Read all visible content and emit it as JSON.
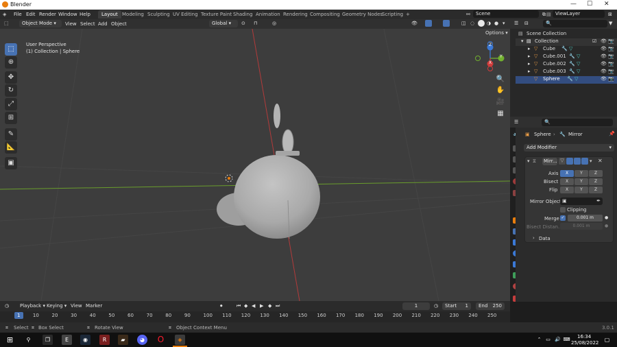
{
  "window": {
    "title": "Blender"
  },
  "menu": [
    "File",
    "Edit",
    "Render",
    "Window",
    "Help"
  ],
  "workspaces": [
    "Layout",
    "Modeling",
    "Sculpting",
    "UV Editing",
    "Texture Paint",
    "Shading",
    "Animation",
    "Rendering",
    "Compositing",
    "Geometry Nodes",
    "Scripting"
  ],
  "active_workspace": "Layout",
  "add_workspace": "+",
  "scene": {
    "name": "Scene",
    "view_layer": "ViewLayer"
  },
  "header3d": {
    "mode": "Object Mode",
    "view": "View",
    "select": "Select",
    "add": "Add",
    "object": "Object",
    "orientation": "Global",
    "options": "Options"
  },
  "viewport": {
    "perspective": "User Perspective",
    "collection_info": "(1) Collection | Sphere"
  },
  "gizmo": {
    "x": "X",
    "y": "Y",
    "z": "Z"
  },
  "outliner": {
    "root": "Scene Collection",
    "collection": "Collection",
    "items": [
      {
        "name": "Cube"
      },
      {
        "name": "Cube.001"
      },
      {
        "name": "Cube.002"
      },
      {
        "name": "Cube.003"
      },
      {
        "name": "Sphere"
      }
    ]
  },
  "properties": {
    "object": "Sphere",
    "modifier_context": "Mirror",
    "add_modifier": "Add Modifier",
    "modifier": {
      "name": "Mirr...",
      "axis_label": "Axis",
      "bisect_label": "Bisect",
      "flip_label": "Flip",
      "axes": [
        "X",
        "Y",
        "Z"
      ],
      "axis_enabled": [
        true,
        false,
        false
      ],
      "mirror_object_label": "Mirror Object",
      "clipping_label": "Clipping",
      "merge_label": "Merge",
      "merge_value": "0.001 m",
      "bisect_distance_label": "Bisect Distan...",
      "bisect_distance_value": "0.001 m",
      "data_label": "Data"
    }
  },
  "timeline": {
    "playback": "Playback",
    "keying": "Keying",
    "view": "View",
    "marker": "Marker",
    "current_frame": "1",
    "start_label": "Start",
    "start": "1",
    "end_label": "End",
    "end": "250",
    "ticks": [
      "1",
      "10",
      "20",
      "30",
      "40",
      "50",
      "60",
      "70",
      "80",
      "90",
      "100",
      "110",
      "120",
      "130",
      "140",
      "150",
      "160",
      "170",
      "180",
      "190",
      "200",
      "210",
      "220",
      "230",
      "240",
      "250"
    ]
  },
  "status": {
    "select": "Select",
    "box_select": "Box Select",
    "rotate_view": "Rotate View",
    "context_menu": "Object Context Menu",
    "version": "3.0.1"
  },
  "taskbar": {
    "time": "16:34",
    "date": "25/08/2022"
  },
  "colors": {
    "accent": "#4772b3",
    "viewport_bg": "#3d3d3d",
    "x_axis": "#d13c3c",
    "y_axis": "#72b02f",
    "z_axis": "#3b79d6",
    "blender_orange": "#e87d0d"
  }
}
